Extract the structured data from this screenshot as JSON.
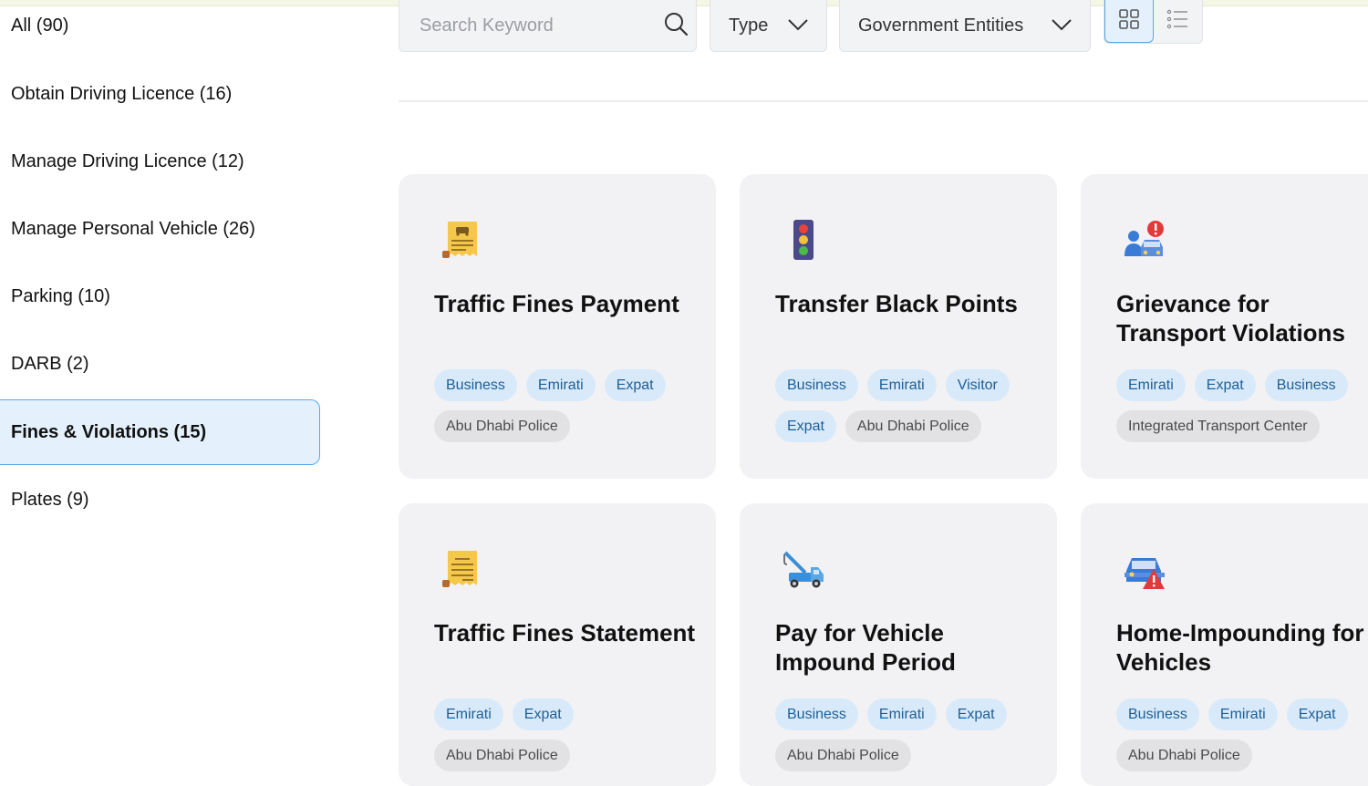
{
  "sidebar": {
    "items": [
      {
        "label": "All (90)"
      },
      {
        "label": "Obtain Driving Licence (16)"
      },
      {
        "label": "Manage Driving Licence (12)"
      },
      {
        "label": "Manage Personal Vehicle (26)"
      },
      {
        "label": "Parking (10)"
      },
      {
        "label": "DARB (2)"
      },
      {
        "label": "Fines & Violations (15)",
        "active": true
      },
      {
        "label": "Plates (9)"
      }
    ]
  },
  "toolbar": {
    "search_placeholder": "Search Keyword",
    "search_value": "",
    "type_label": "Type",
    "entities_label": "Government Entities",
    "view_mode": "grid"
  },
  "colors": {
    "active_bg": "#e4f1fc",
    "active_border": "#5aa7e6",
    "audience_tag_bg": "#d8eafa",
    "audience_tag_text": "#1e5e96",
    "entity_tag_bg": "#e2e2e4",
    "card_bg": "#f2f2f4"
  },
  "cards": [
    {
      "title": "Traffic Fines Payment",
      "icon": "traffic-fine-receipt-icon",
      "audience": [
        "Business",
        "Emirati",
        "Expat"
      ],
      "entity": "Abu Dhabi Police"
    },
    {
      "title": "Transfer Black Points",
      "icon": "traffic-light-icon",
      "audience": [
        "Business",
        "Emirati",
        "Visitor",
        "Expat"
      ],
      "entity": "Abu Dhabi Police"
    },
    {
      "title": "Grievance for Transport Violations",
      "icon": "person-car-alert-icon",
      "audience": [
        "Emirati",
        "Expat",
        "Business"
      ],
      "entity": "Integrated Transport Center"
    },
    {
      "title": "Traffic Fines Statement",
      "icon": "statement-receipt-icon",
      "audience": [
        "Emirati",
        "Expat"
      ],
      "entity": "Abu Dhabi Police"
    },
    {
      "title": "Pay for Vehicle Impound Period",
      "icon": "tow-truck-icon",
      "audience": [
        "Business",
        "Emirati",
        "Expat"
      ],
      "entity": "Abu Dhabi Police"
    },
    {
      "title": "Home-Impounding for Vehicles",
      "icon": "car-warning-icon",
      "audience": [
        "Business",
        "Emirati",
        "Expat"
      ],
      "entity": "Abu Dhabi Police"
    }
  ]
}
